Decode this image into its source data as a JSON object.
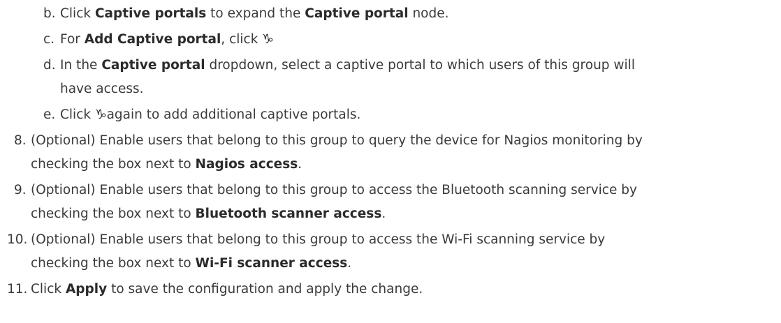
{
  "steps": {
    "b": {
      "marker": "b.",
      "t1": "Click ",
      "b1": "Captive portals",
      "t2": " to expand the ",
      "b2": "Captive portal",
      "t3": " node."
    },
    "c": {
      "marker": "c.",
      "t1": "For ",
      "b1": "Add Captive portal",
      "t2": ", click ",
      "icon": "♑",
      "icon_name": "add-icon"
    },
    "d": {
      "marker": "d.",
      "t1": "In the ",
      "b1": "Captive portal",
      "t2": " dropdown, select a captive portal to which users of this group will",
      "line2": "have access."
    },
    "e": {
      "marker": "e.",
      "t1": "Click ",
      "icon": "♑",
      "icon_name": "add-icon",
      "t2": "again to add additional captive portals."
    },
    "s8": {
      "marker": "8.",
      "line1": "(Optional) Enable users that belong to this group to query the device for Nagios monitoring by",
      "t1": "checking the box next to ",
      "b1": "Nagios access",
      "t2": "."
    },
    "s9": {
      "marker": "9.",
      "line1": "(Optional) Enable users that belong to this group to access the Bluetooth scanning service by",
      "t1": "checking the box next to ",
      "b1": "Bluetooth scanner access",
      "t2": "."
    },
    "s10": {
      "marker": "10.",
      "line1": "(Optional) Enable users that belong to this group to access the Wi-Fi scanning service by",
      "t1": "checking the box next to ",
      "b1": "Wi-Fi scanner access",
      "t2": "."
    },
    "s11": {
      "marker": "11.",
      "t1": "Click ",
      "b1": "Apply",
      "t2": " to save the configuration and apply the change."
    }
  }
}
